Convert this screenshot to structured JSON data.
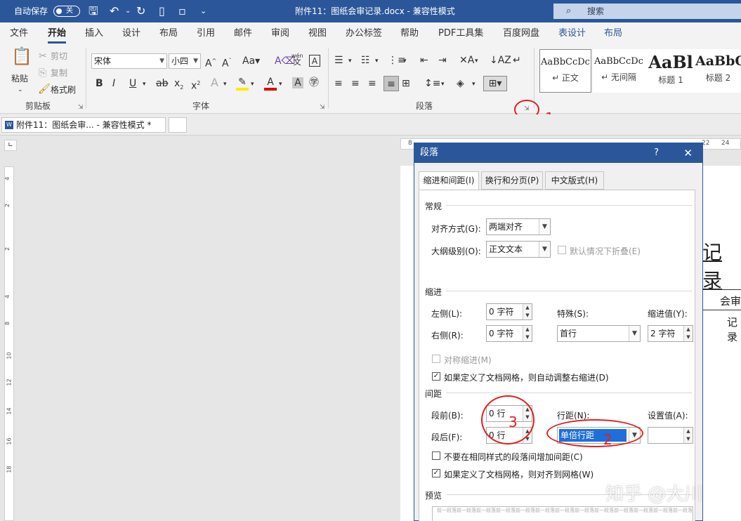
{
  "titlebar": {
    "autosave_label": "自动保存",
    "autosave_state": "关",
    "doc_title": "附件11：图纸会审记录.docx  -  兼容性模式",
    "search_label": "搜索"
  },
  "tabs": [
    "文件",
    "开始",
    "插入",
    "设计",
    "布局",
    "引用",
    "邮件",
    "审阅",
    "视图",
    "办公标签",
    "帮助",
    "PDF工具集",
    "百度网盘",
    "表设计",
    "布局"
  ],
  "ribbon": {
    "clipboard": {
      "paste": "粘贴",
      "cut": "剪切",
      "copy": "复制",
      "format_painter": "格式刷",
      "group": "剪贴板"
    },
    "font": {
      "font_name": "宋体",
      "font_size": "小四",
      "wen": "wén",
      "wen2": "文",
      "A": "A",
      "group": "字体"
    },
    "paragraph": {
      "group": "段落"
    },
    "styles": [
      {
        "sample": "AaBbCcDc",
        "name": "↵ 正文"
      },
      {
        "sample": "AaBbCcDc",
        "name": "↵ 无间隔"
      },
      {
        "sample": "AaBl",
        "name": "标题 1"
      },
      {
        "sample": "AaBbC",
        "name": "标题 2"
      }
    ]
  },
  "doctab": {
    "label": "附件11：图纸会审...  -  兼容性模式 *",
    "close": "×"
  },
  "ruler": {
    "top": [
      "8",
      "22",
      "24"
    ],
    "left": [
      "4",
      "2",
      "2",
      "4",
      "6",
      "8",
      "10",
      "12",
      "14",
      "16",
      "18"
    ]
  },
  "document": {
    "heading": "记录",
    "cell1": "会审",
    "cell2": "记录"
  },
  "dialog": {
    "title": "段落",
    "help": "?",
    "close": "✕",
    "tabs": [
      "缩进和间距(I)",
      "换行和分页(P)",
      "中文版式(H)"
    ],
    "general": {
      "section": "常规",
      "alignment_label": "对齐方式(G):",
      "alignment_value": "两端对齐",
      "outline_label": "大纲级别(O):",
      "outline_value": "正文文本",
      "collapse_label": "默认情况下折叠(E)"
    },
    "indent": {
      "section": "缩进",
      "left_label": "左侧(L):",
      "left_value": "0 字符",
      "right_label": "右侧(R):",
      "right_value": "0 字符",
      "special_label": "特殊(S):",
      "special_value": "首行",
      "by_label": "缩进值(Y):",
      "by_value": "2 字符",
      "mirror_label": "对称缩进(M)",
      "auto_adjust_label": "如果定义了文档网格，则自动调整右缩进(D)"
    },
    "spacing": {
      "section": "间距",
      "before_label": "段前(B):",
      "before_value": "0 行",
      "after_label": "段后(F):",
      "after_value": "0 行",
      "line_label": "行距(N):",
      "line_value": "单倍行距",
      "at_label": "设置值(A):",
      "at_value": "",
      "no_space_label": "不要在相同样式的段落间增加间距(C)",
      "snap_label": "如果定义了文档网格，则对齐到网格(W)"
    },
    "preview": {
      "section": "预览",
      "text": "前一段落前一段落前一段落前一段落前一段落前一段落前一段落前一段落前一段落前一段落前一段落前一段落前一段落前一段落前一段落前一段落"
    }
  },
  "annotations": {
    "n1": "1",
    "n2": "2",
    "n3": "3",
    "accent": "#e02020"
  },
  "watermark": "知乎 @大川"
}
